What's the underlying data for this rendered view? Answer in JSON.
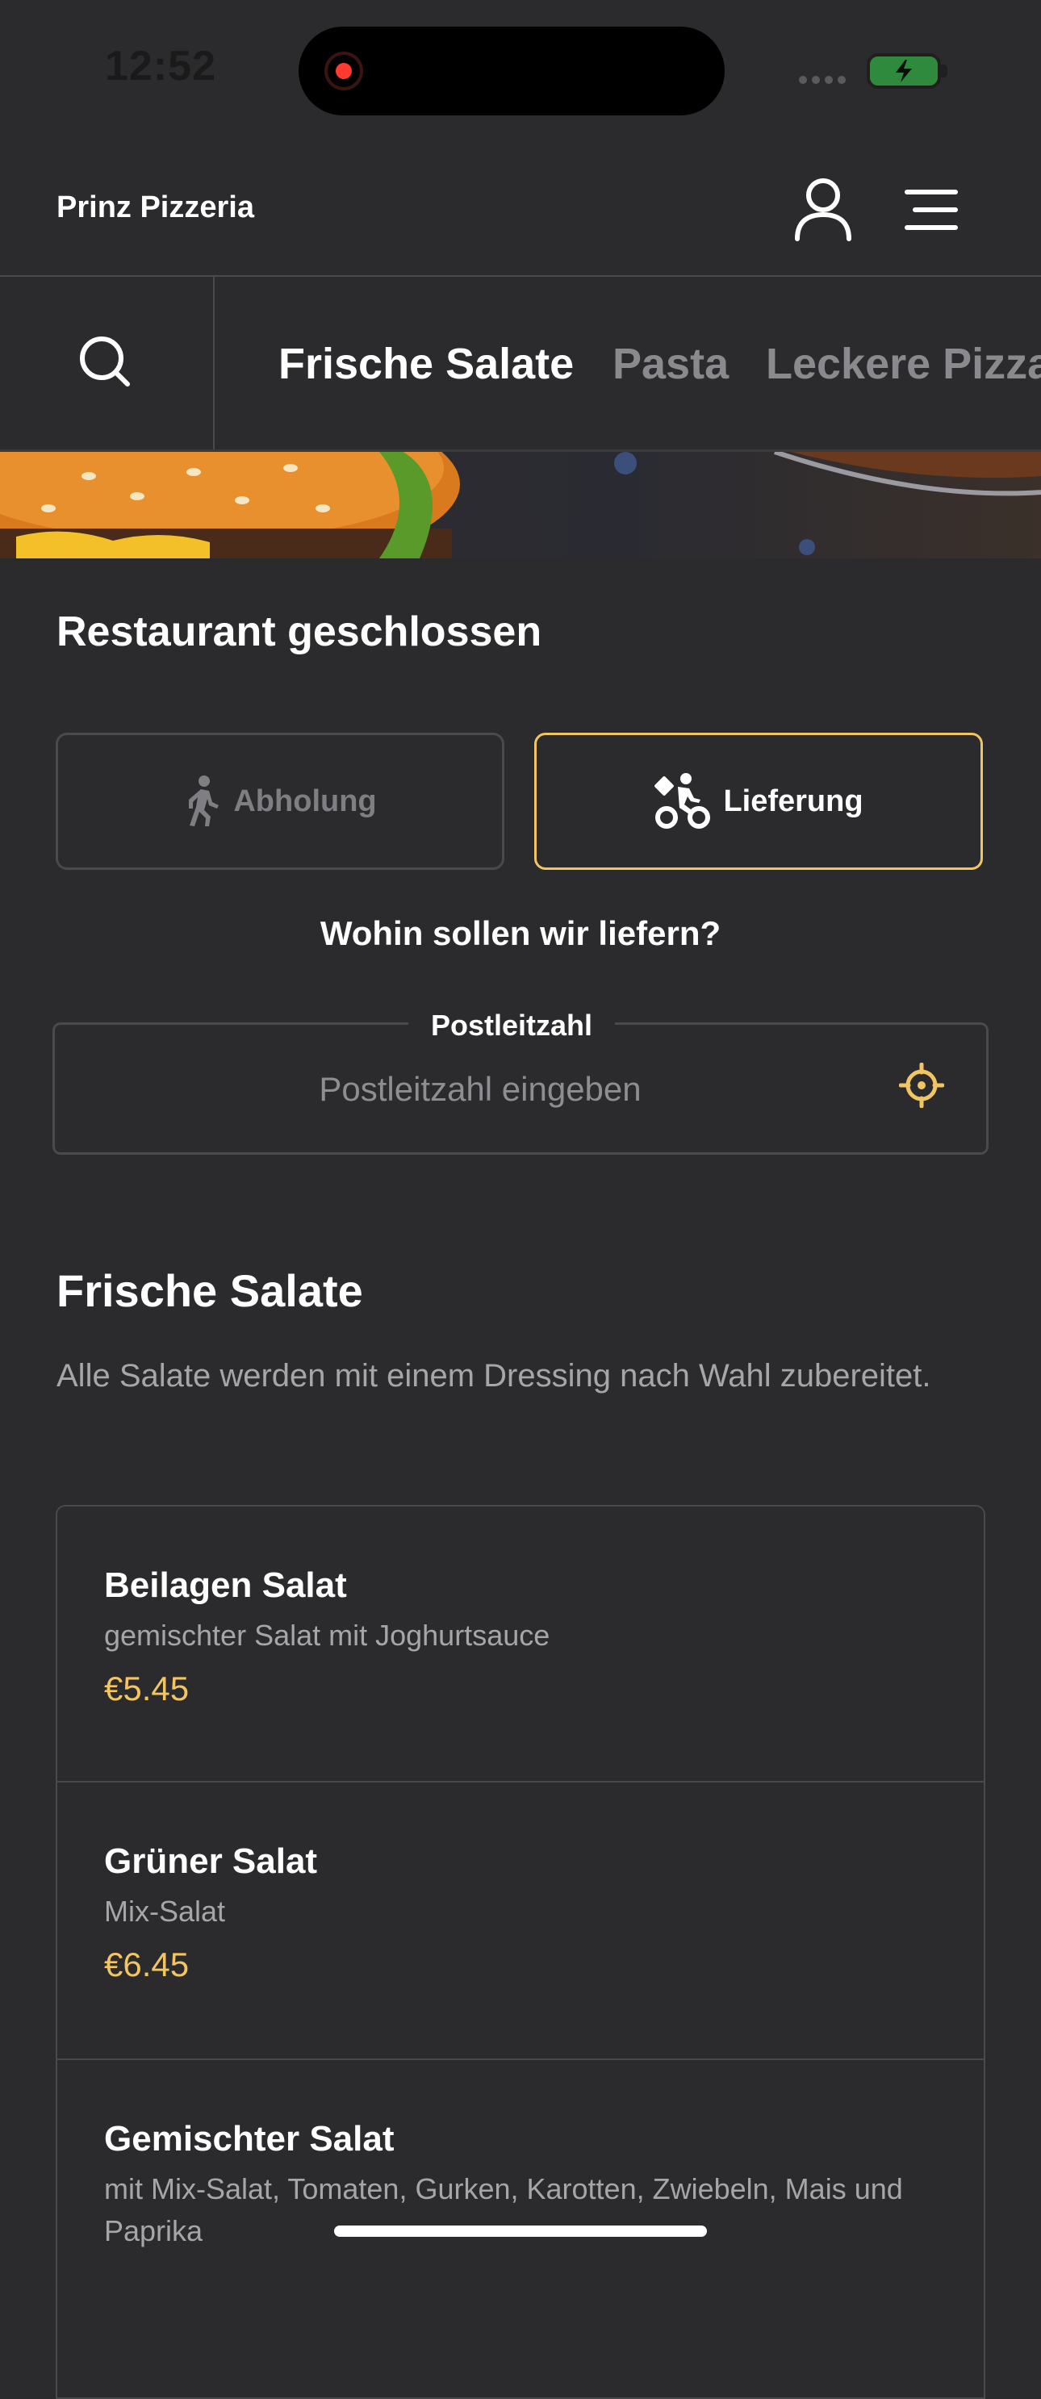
{
  "status_bar": {
    "time": "12:52"
  },
  "header": {
    "brand": "Prinz Pizzeria"
  },
  "categories": {
    "tabs": [
      {
        "label": "Frische Salate",
        "active": true
      },
      {
        "label": "Pasta",
        "active": false
      },
      {
        "label": "Leckere Pizza",
        "active": false
      }
    ]
  },
  "restaurant": {
    "status_title": "Restaurant geschlossen"
  },
  "order_mode": {
    "pickup_label": "Abholung",
    "delivery_label": "Lieferung",
    "selected": "delivery"
  },
  "delivery": {
    "question": "Wohin sollen wir liefern?",
    "zip_label": "Postleitzahl",
    "zip_placeholder": "Postleitzahl eingeben",
    "zip_value": ""
  },
  "section": {
    "title": "Frische Salate",
    "description": "Alle Salate werden mit einem Dressing nach Wahl zubereitet."
  },
  "menu_items": [
    {
      "name": "Beilagen Salat",
      "description": "gemischter Salat mit Joghurtsauce",
      "price": "€5.45"
    },
    {
      "name": "Grüner Salat",
      "description": "Mix-Salat",
      "price": "€6.45"
    },
    {
      "name": "Gemischter Salat",
      "description": "mit Mix-Salat, Tomaten, Gurken, Karotten, Zwiebeln, Mais und Paprika",
      "price": ""
    }
  ],
  "colors": {
    "background": "#2b2a2c",
    "accent": "#f2c564",
    "divider": "#4a494c",
    "muted_text": "#a6a5a9"
  },
  "icons": {
    "account": "user-icon",
    "menu": "hamburger-menu-icon",
    "search": "search-icon",
    "pickup": "walking-person-icon",
    "delivery": "bike-courier-icon",
    "locate": "crosshair-location-icon"
  }
}
